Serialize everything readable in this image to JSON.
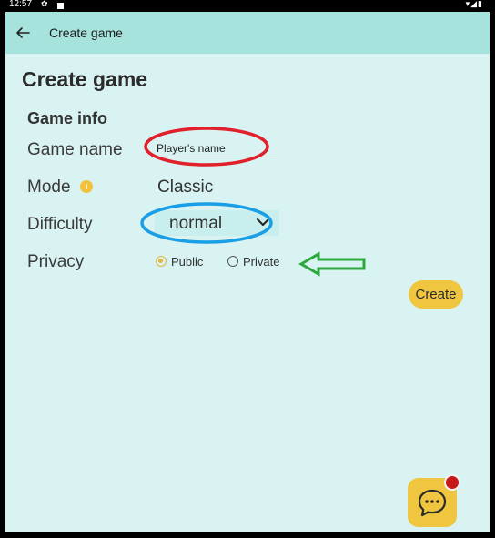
{
  "status_bar": {
    "time": "12:57",
    "icons_left": [
      "gear-icon",
      "square-icon"
    ],
    "icons_right": "▾◢▮"
  },
  "app_bar": {
    "title": "Create game",
    "back_icon": "arrow-left-icon"
  },
  "page": {
    "title": "Create game",
    "section_title": "Game info"
  },
  "form": {
    "game_name_label": "Game name",
    "game_name_value": "Player's name",
    "mode_label": "Mode",
    "mode_info_icon": "i",
    "mode_value": "Classic",
    "difficulty_label": "Difficulty",
    "difficulty_value": "normal",
    "privacy_label": "Privacy",
    "privacy_options": [
      {
        "label": "Public",
        "selected": true
      },
      {
        "label": "Private",
        "selected": false
      }
    ]
  },
  "actions": {
    "create_label": "Create"
  },
  "colors": {
    "app_bar_bg": "#a7e3dd",
    "content_bg": "#d9f3f2",
    "accent_yellow": "#f0c540",
    "notification_red": "#c61a1a",
    "annotation_red": "#e0202a",
    "annotation_blue": "#1a9ee6",
    "annotation_green": "#2aa83a"
  }
}
